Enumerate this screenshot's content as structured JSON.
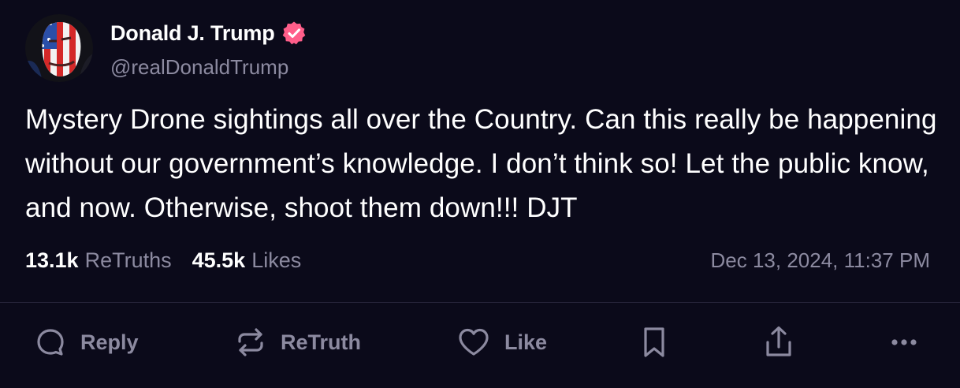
{
  "author": {
    "display_name": "Donald J. Trump",
    "handle": "@realDonaldTrump",
    "verified": true,
    "verified_icon": "verified-badge-icon",
    "verified_color": "#ff5e8a"
  },
  "post": {
    "text": "Mystery Drone sightings all over the Country. Can this really be happening without our government’s knowledge. I don’t think so! Let the public know, and now. Otherwise, shoot them down!!! DJT"
  },
  "stats": {
    "retruths_count": "13.1k",
    "retruths_label": "ReTruths",
    "likes_count": "45.5k",
    "likes_label": "Likes",
    "timestamp": "Dec 13, 2024, 11:37 PM"
  },
  "actions": {
    "reply_label": "Reply",
    "retruth_label": "ReTruth",
    "like_label": "Like",
    "bookmark_icon": "bookmark-icon",
    "share_icon": "share-icon",
    "more_icon": "more-icon"
  },
  "colors": {
    "background": "#0b0a1a",
    "text": "#ffffff",
    "muted": "#8c8aa0",
    "divider": "#26243a"
  }
}
